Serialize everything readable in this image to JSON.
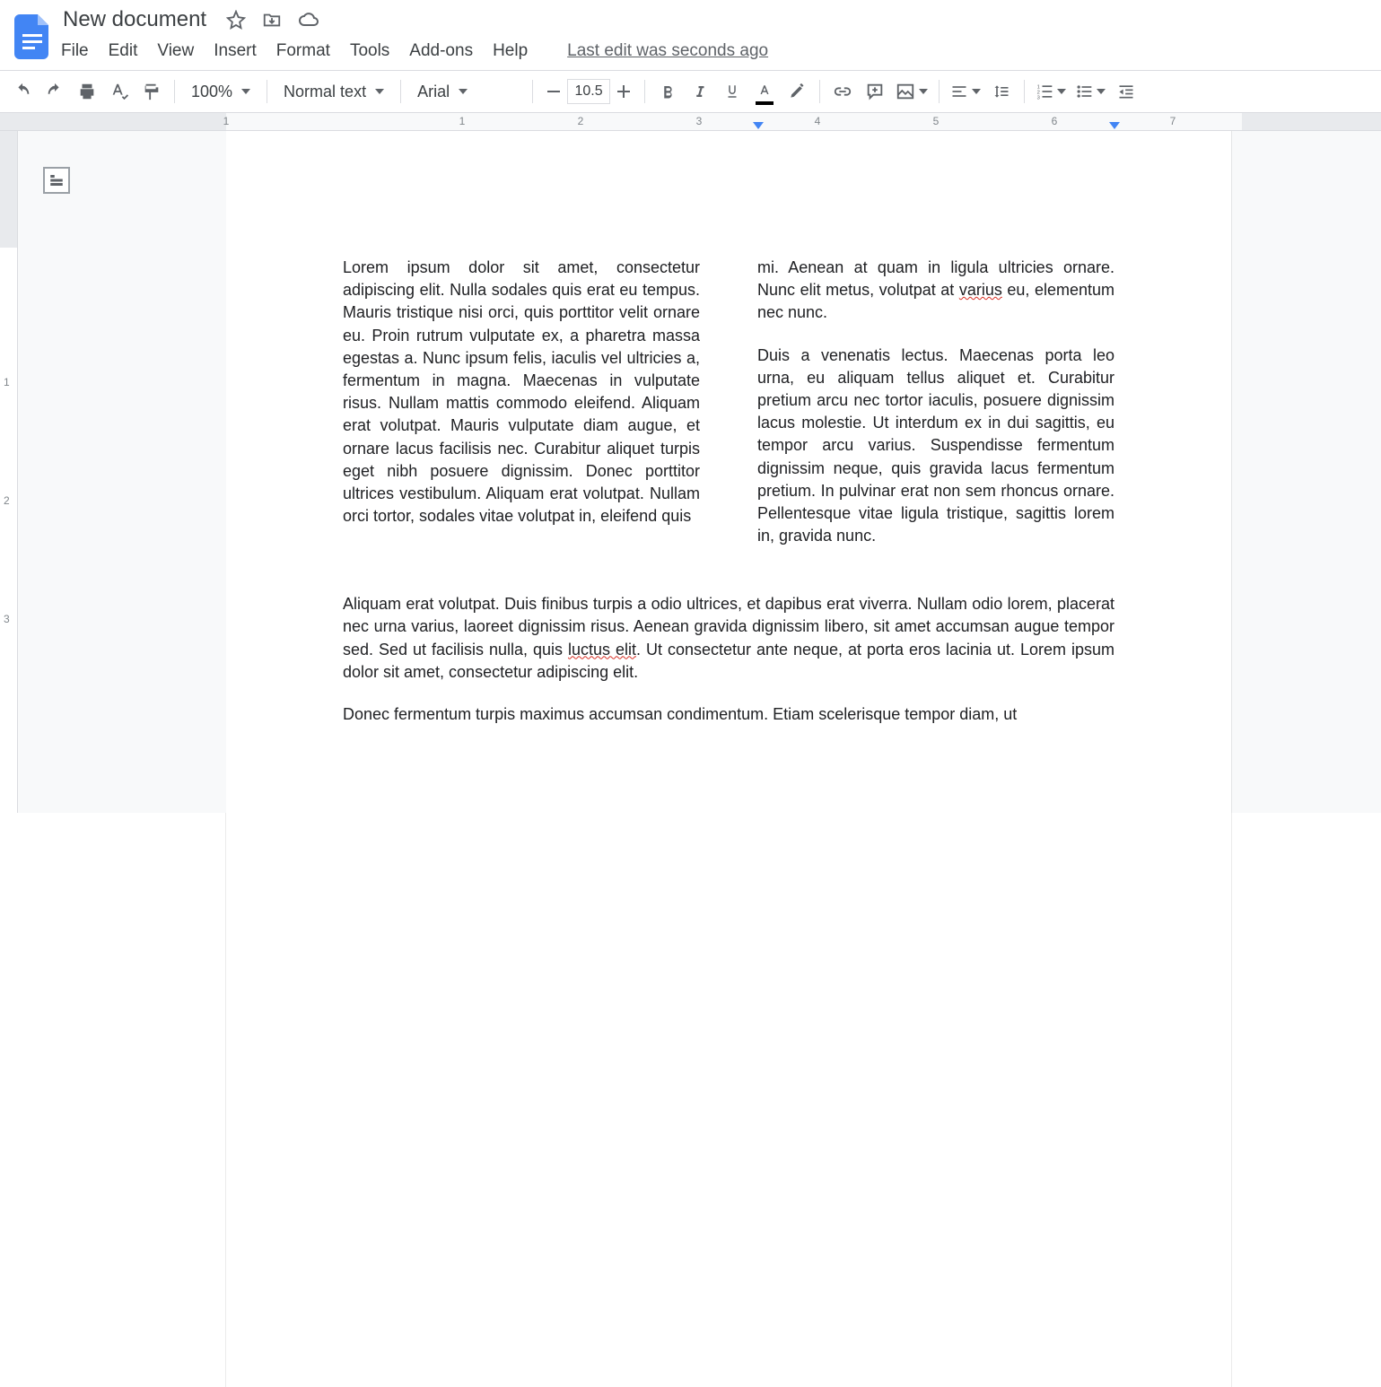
{
  "doc_title": "New document",
  "menu": {
    "file": "File",
    "edit": "Edit",
    "view": "View",
    "insert": "Insert",
    "format": "Format",
    "tools": "Tools",
    "addons": "Add-ons",
    "help": "Help"
  },
  "last_edit": "Last edit was seconds ago",
  "toolbar": {
    "zoom": "100%",
    "style": "Normal text",
    "font": "Arial",
    "font_size": "10.5"
  },
  "ruler": {
    "numbers": [
      "1",
      "1",
      "2",
      "3",
      "4",
      "5",
      "6",
      "7"
    ]
  },
  "vruler": {
    "numbers": [
      "1",
      "2",
      "3"
    ]
  },
  "content": {
    "col_a": "Lorem ipsum dolor sit amet, consectetur adipiscing elit. Nulla sodales quis erat eu tempus. Mauris tristique nisi orci, quis porttitor velit ornare eu. Proin rutrum vulputate ex, a pharetra massa egestas a. Nunc ipsum felis, iaculis vel ultricies a, fermentum in magna. Maecenas in vulputate risus. Nullam mattis commodo eleifend. Aliquam erat volutpat. Mauris vulputate diam augue, et ornare lacus facilisis nec. Curabitur aliquet turpis eget nibh posuere dignissim. Donec porttitor ultrices vestibulum. Aliquam erat volutpat. Nullam orci tortor, sodales vitae volutpat in, eleifend quis",
    "col_b1_pre": "mi. Aenean at quam in ligula ultricies ornare. Nunc elit metus, volutpat at ",
    "col_b1_sp": "varius",
    "col_b1_post": " eu, elementum nec nunc.",
    "col_b2": "Duis a venenatis lectus. Maecenas porta leo urna, eu aliquam tellus aliquet et. Curabitur pretium arcu nec tortor iaculis, posuere dignissim lacus molestie. Ut interdum ex in dui sagittis, eu tempor arcu varius. Suspendisse fermentum dignissim neque, quis gravida lacus fermentum pretium. In pulvinar erat non sem rhoncus ornare. Pellentesque vitae ligula tristique, sagittis lorem in, gravida nunc.",
    "full1_pre": "Aliquam erat volutpat. Duis finibus turpis a odio ultrices, et dapibus erat viverra. Nullam odio lorem, placerat nec urna varius, laoreet dignissim risus. Aenean gravida dignissim libero, sit amet accumsan augue tempor sed. Sed ut facilisis nulla, quis ",
    "full1_sp": "luctus elit",
    "full1_post": ". Ut consectetur ante neque, at porta eros lacinia ut. Lorem ipsum dolor sit amet, consectetur adipiscing elit.",
    "full2": "Donec fermentum turpis maximus accumsan condimentum. Etiam scelerisque tempor diam, ut"
  }
}
